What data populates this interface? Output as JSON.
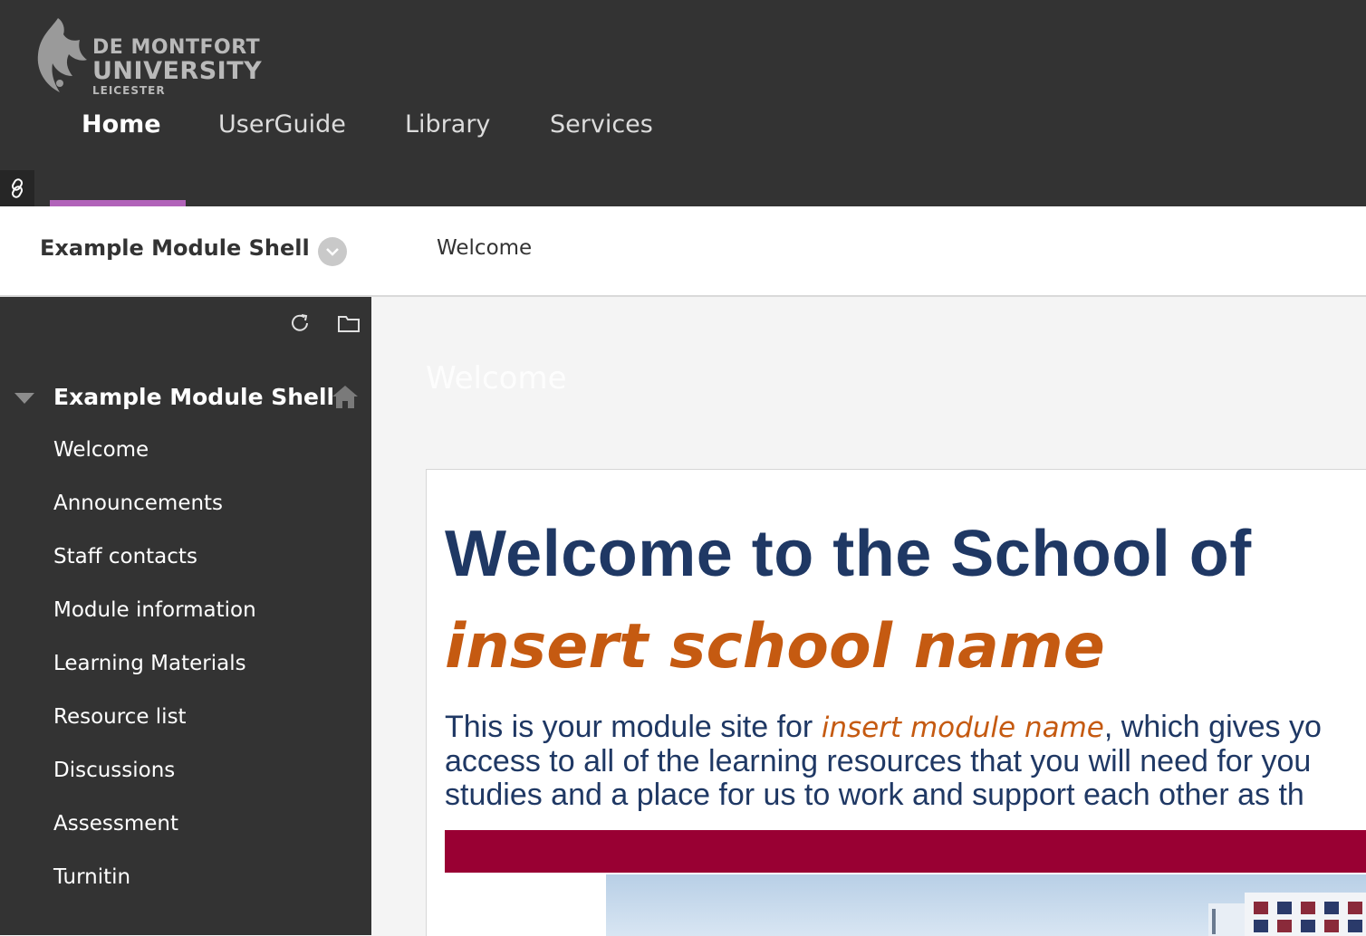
{
  "logo": {
    "line1": "DE MONTFORT",
    "line2": "UNIVERSITY",
    "line3": "LEICESTER"
  },
  "nav": {
    "items": [
      {
        "label": "Home",
        "active": true
      },
      {
        "label": "UserGuide",
        "active": false
      },
      {
        "label": "Library",
        "active": false
      },
      {
        "label": "Services",
        "active": false
      }
    ]
  },
  "course": {
    "title": "Example Module Shell",
    "breadcrumb": "Welcome"
  },
  "sidebar": {
    "header": "Example Module Shell",
    "items": [
      "Welcome",
      "Announcements",
      "Staff contacts",
      "Module information",
      "Learning Materials",
      "Resource list",
      "Discussions",
      "Assessment",
      "Turnitin"
    ]
  },
  "content": {
    "page_title": "Welcome",
    "heading": "Welcome to the School of",
    "school_name": "insert school name",
    "para_start": "This is your module site for ",
    "module_name": "insert module name",
    "para_line1_end": ", which gives yo",
    "para_line2": "access to all of the learning resources that you will need for you",
    "para_line3": "studies and a place for us to work and support each other as th"
  },
  "colors": {
    "header_bg": "#333333",
    "nav_accent": "#b163b9",
    "heading_blue": "#1f3864",
    "accent_orange": "#c55a11",
    "banner_red": "#990033"
  }
}
